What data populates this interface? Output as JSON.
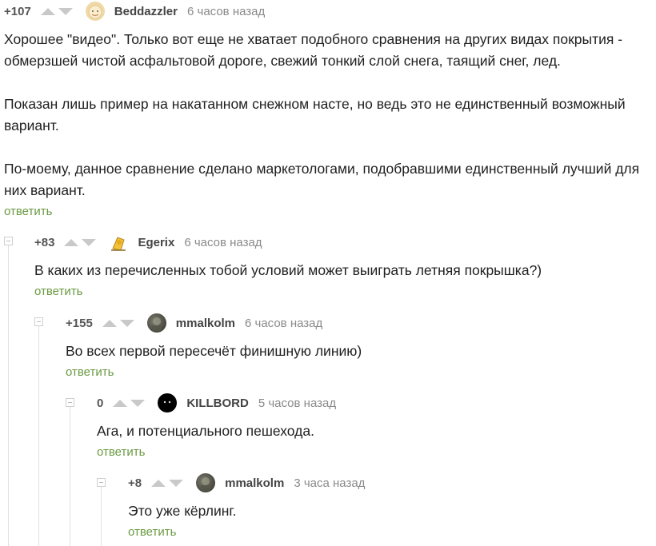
{
  "comments": [
    {
      "score": "+107",
      "author": "Beddazzler",
      "time": "6 часов назад",
      "paragraphs": [
        "Хорошее \"видео\". Только вот еще не хватает подобного сравнения на других видах покрытия - обмерзшей чистой асфальтовой дороге, свежий тонкий слой снега, таящий снег, лед.",
        "Показан лишь пример на накатанном снежном насте, но ведь это не единственный возможный вариант.",
        "По-моему, данное сравнение сделано маркетологами, подобравшими единственный лучший для них вариант."
      ],
      "reply": "ответить"
    },
    {
      "score": "+83",
      "author": "Egerix",
      "time": "6 часов назад",
      "text": "В каких из перечисленных тобой условий может выиграть летняя покрышка?)",
      "reply": "ответить"
    },
    {
      "score": "+155",
      "author": "mmalkolm",
      "time": "6 часов назад",
      "text": "Во всех первой пересечёт финишную линию)",
      "reply": "ответить"
    },
    {
      "score": "0",
      "author": "KILLBORD",
      "time": "5 часов назад",
      "text": "Ага, и потенциального пешехода.",
      "reply": "ответить"
    },
    {
      "score": "+8",
      "author": "mmalkolm",
      "time": "3 часа назад",
      "text": "Это уже кёрлинг.",
      "reply": "ответить"
    }
  ],
  "colors": {
    "reply_link": "#6a9a42",
    "vote_arrow": "#c9c9c9",
    "thread_line": "#e1e1e1"
  },
  "icons": [
    "upvote-icon",
    "downvote-icon",
    "collapse-icon",
    "avatar"
  ]
}
